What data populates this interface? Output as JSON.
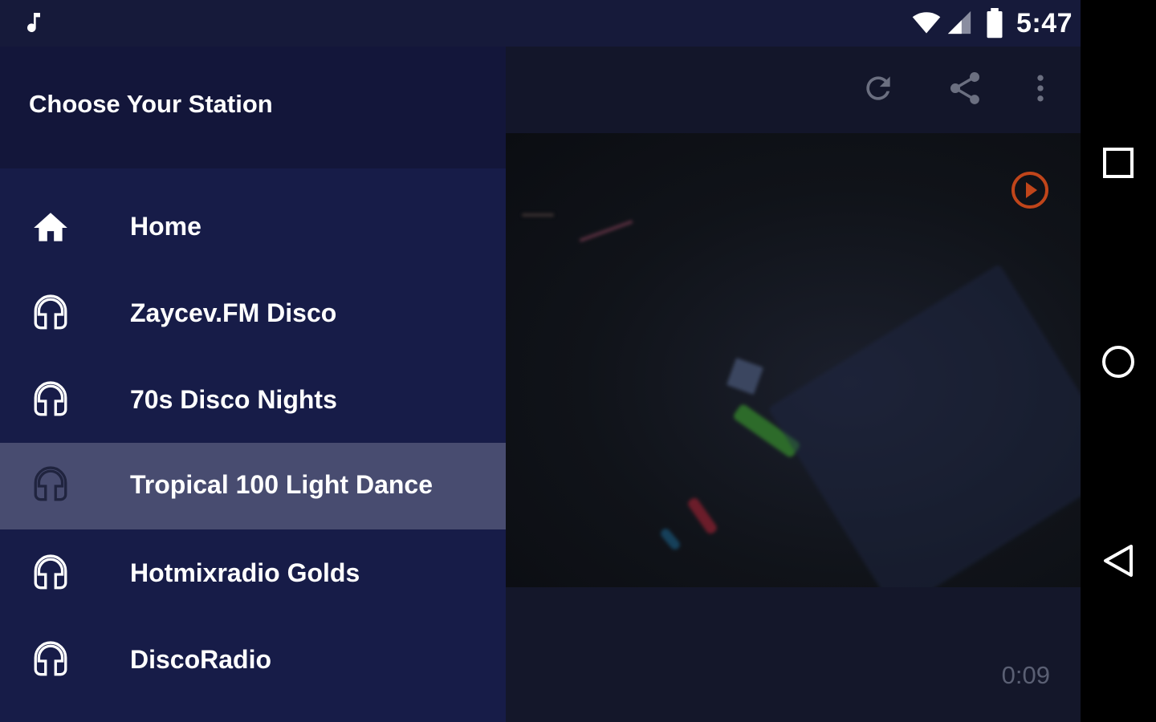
{
  "status_bar": {
    "time": "5:47",
    "notification_icon": "music-note-icon",
    "icons": [
      "wifi-icon",
      "signal-icon",
      "battery-icon"
    ]
  },
  "drawer": {
    "title": "Choose Your Station",
    "items": [
      {
        "label": "Home",
        "icon": "home-icon",
        "selected": false
      },
      {
        "label": "Zaycev.FM Disco",
        "icon": "headphones-icon",
        "selected": false
      },
      {
        "label": "70s Disco Nights",
        "icon": "headphones-icon",
        "selected": false
      },
      {
        "label": "Tropical 100 Light Dance",
        "icon": "headphones-icon",
        "selected": true
      },
      {
        "label": "Hotmixradio Golds",
        "icon": "headphones-icon",
        "selected": false
      },
      {
        "label": "DiscoRadio",
        "icon": "headphones-icon",
        "selected": false
      }
    ]
  },
  "toolbar": {
    "icons": [
      "refresh-icon",
      "share-icon",
      "more-vert-icon"
    ]
  },
  "player": {
    "elapsed": "0:09",
    "play_icon": "play-circle-icon"
  },
  "nav_bar": {
    "buttons": [
      "recents-button",
      "home-button",
      "back-button"
    ]
  },
  "colors": {
    "drawer_bg": "#171c48",
    "drawer_header_bg": "#13163a",
    "selected_item_bg": "#484c70",
    "accent_orange": "#c0451a",
    "status_bar_bg": "#161a3a"
  }
}
